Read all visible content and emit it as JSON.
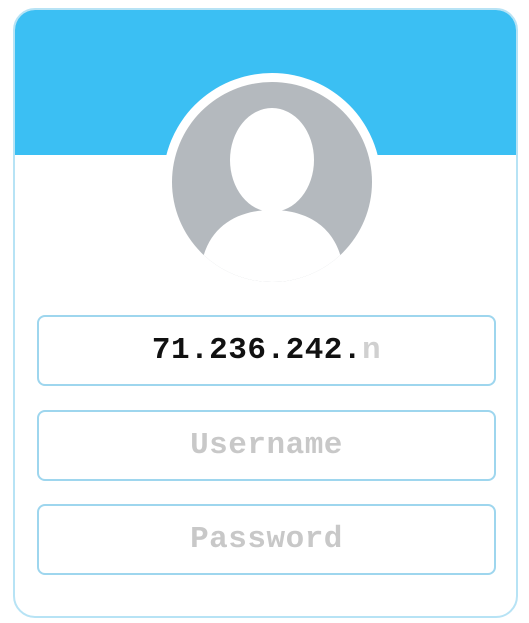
{
  "login": {
    "address_field": {
      "typed_value": "71.236.242.",
      "placeholder_remainder": "n"
    },
    "username_field": {
      "placeholder": "Username"
    },
    "password_field": {
      "placeholder": "Password"
    }
  },
  "colors": {
    "header": "#3bbff3",
    "avatar_background": "#b4b9be",
    "field_border": "#9ed6ee"
  },
  "icons": {
    "avatar": "user-silhouette-icon"
  }
}
